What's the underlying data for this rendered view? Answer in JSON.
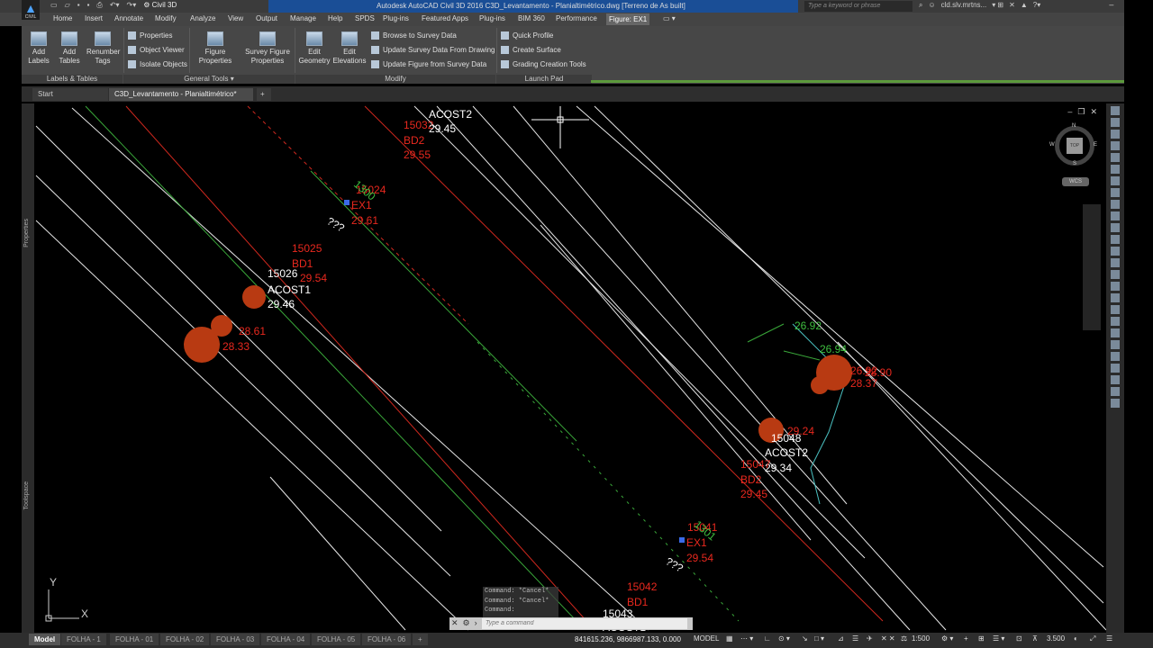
{
  "app": {
    "logo_label": "CIVIL",
    "workspace": "Civil 3D",
    "title": "Autodesk AutoCAD Civil 3D 2016    C3D_Levantamento - Planialtimétrico.dwg [Terreno de As built]",
    "search_placeholder": "Type a keyword or phrase",
    "user": "cld.slv.mrtns..."
  },
  "menu_tabs": [
    "Home",
    "Insert",
    "Annotate",
    "Modify",
    "Analyze",
    "View",
    "Output",
    "Manage",
    "Help",
    "SPDS",
    "Plug-ins",
    "Featured Apps",
    "Plug-ins",
    "BIM 360",
    "Performance",
    "Figure: EX1"
  ],
  "ribbon": {
    "add_labels": "Add Labels",
    "add_tables": "Add Tables",
    "renumber_tags": "Renumber Tags",
    "properties": "Properties",
    "object_viewer": "Object Viewer",
    "isolate_objects": "Isolate Objects",
    "figure_properties": "Figure Properties",
    "survey_figure_properties": "Survey Figure Properties",
    "edit_geometry": "Edit Geometry",
    "edit_elevations": "Edit Elevations",
    "browse_survey_data": "Browse to Survey Data",
    "update_from_drawing": "Update Survey Data From Drawing",
    "update_from_survey": "Update Figure from Survey Data",
    "quick_profile": "Quick Profile",
    "create_surface": "Create Surface",
    "grading_tools": "Grading Creation Tools",
    "panel_labels_tables": "Labels & Tables",
    "panel_general_tools": "General Tools ▾",
    "panel_modify": "Modify",
    "panel_launch_pad": "Launch Pad"
  },
  "file_tabs": {
    "start": "Start",
    "active": "C3D_Levantamento - Planialtimétrico*"
  },
  "side_palettes": {
    "properties": "Properties",
    "toolspace": "Toolspace"
  },
  "viewcube": {
    "top": "TOP",
    "n": "N",
    "s": "S",
    "e": "E",
    "w": "W",
    "wcs": "WCS"
  },
  "drawing_labels": {
    "top_code": "15032",
    "top_desc": "ACOST2",
    "top_elev": "29.45",
    "top_bd": "BD2",
    "top_bd_elev": "29.55",
    "ex_num": "15024",
    "ex_code": "EX1",
    "ex_elev": "29.61",
    "ex_fig": "1300",
    "q1": "???",
    "p25": "15025",
    "bd1": "BD1",
    "bd1_elev": "29.54",
    "p26": "15026",
    "acost1": "ACOST1",
    "acost1_elev": "29.46",
    "tree_a": "28.61",
    "tree_b": "28.33",
    "g1": "26.92",
    "g2": "26.94",
    "r_tree_a": "26.92",
    "r_tree_b": "28.90",
    "r_tree_c": "28.37",
    "m_tree": "29.24",
    "p48": "15048",
    "m_acost2": "ACOST2",
    "m_acost2_elev": "29.34",
    "p47": "15047",
    "m_bd2": "BD2",
    "m_bd2_elev": "29.45",
    "p41": "15041",
    "ex1b": "EX1",
    "ex1b_fig": "1301",
    "ex1b_elev": "29.54",
    "q2": "???",
    "p42": "15042",
    "bd1b": "BD1",
    "p43": "15043",
    "acost1b": "ACOST1",
    "ucs_x": "X",
    "ucs_y": "Y"
  },
  "command": {
    "history": [
      "Command: *Cancel*",
      "Command: *Cancel*",
      "Command:"
    ],
    "placeholder": "Type a command"
  },
  "status": {
    "layouts": [
      "Model",
      "FOLHA - 1",
      "FOLHA - 01",
      "FOLHA - 02",
      "FOLHA - 03",
      "FOLHA - 04",
      "FOLHA - 05",
      "FOLHA - 06",
      "+"
    ],
    "coords": "841615.236, 9866987.133, 0.000",
    "model": "MODEL",
    "scale": "1:500",
    "elev_scale": "3.500"
  },
  "colors": {
    "red_text": "#e8281e",
    "white_text": "#ffffff",
    "green_text": "#3fbf3f",
    "tree": "#b83a12",
    "title_blue": "#1a4e96"
  }
}
